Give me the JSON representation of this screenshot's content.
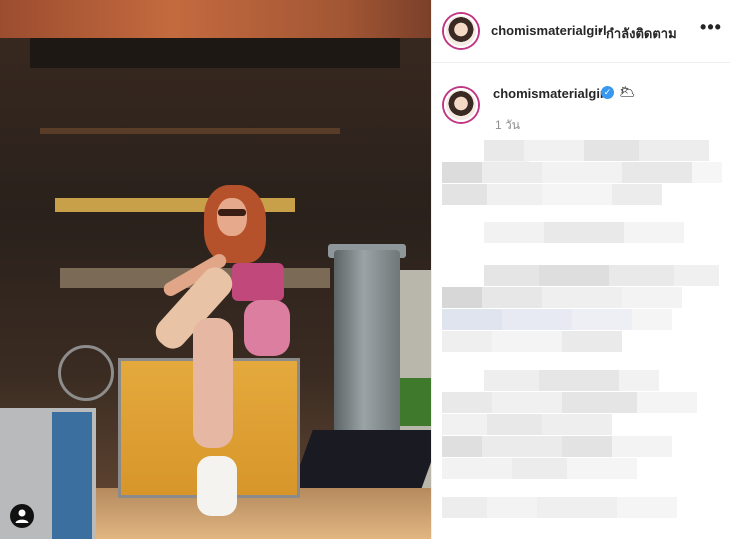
{
  "post": {
    "header": {
      "username": "chomismaterialgirl",
      "separator": "•",
      "follow_label": "กำลังติดตาม",
      "more_label": "•••"
    },
    "caption": {
      "username": "chomismaterialgirl",
      "verified_mark": "✓",
      "emoji": "🌥",
      "timestamp": "1 วัน"
    },
    "icons": {
      "more": "more-options-icon",
      "verified": "verified-badge-icon",
      "user": "user-tag-icon"
    },
    "colors": {
      "verified": "#3897f0",
      "story_ring": "#c13584"
    }
  }
}
